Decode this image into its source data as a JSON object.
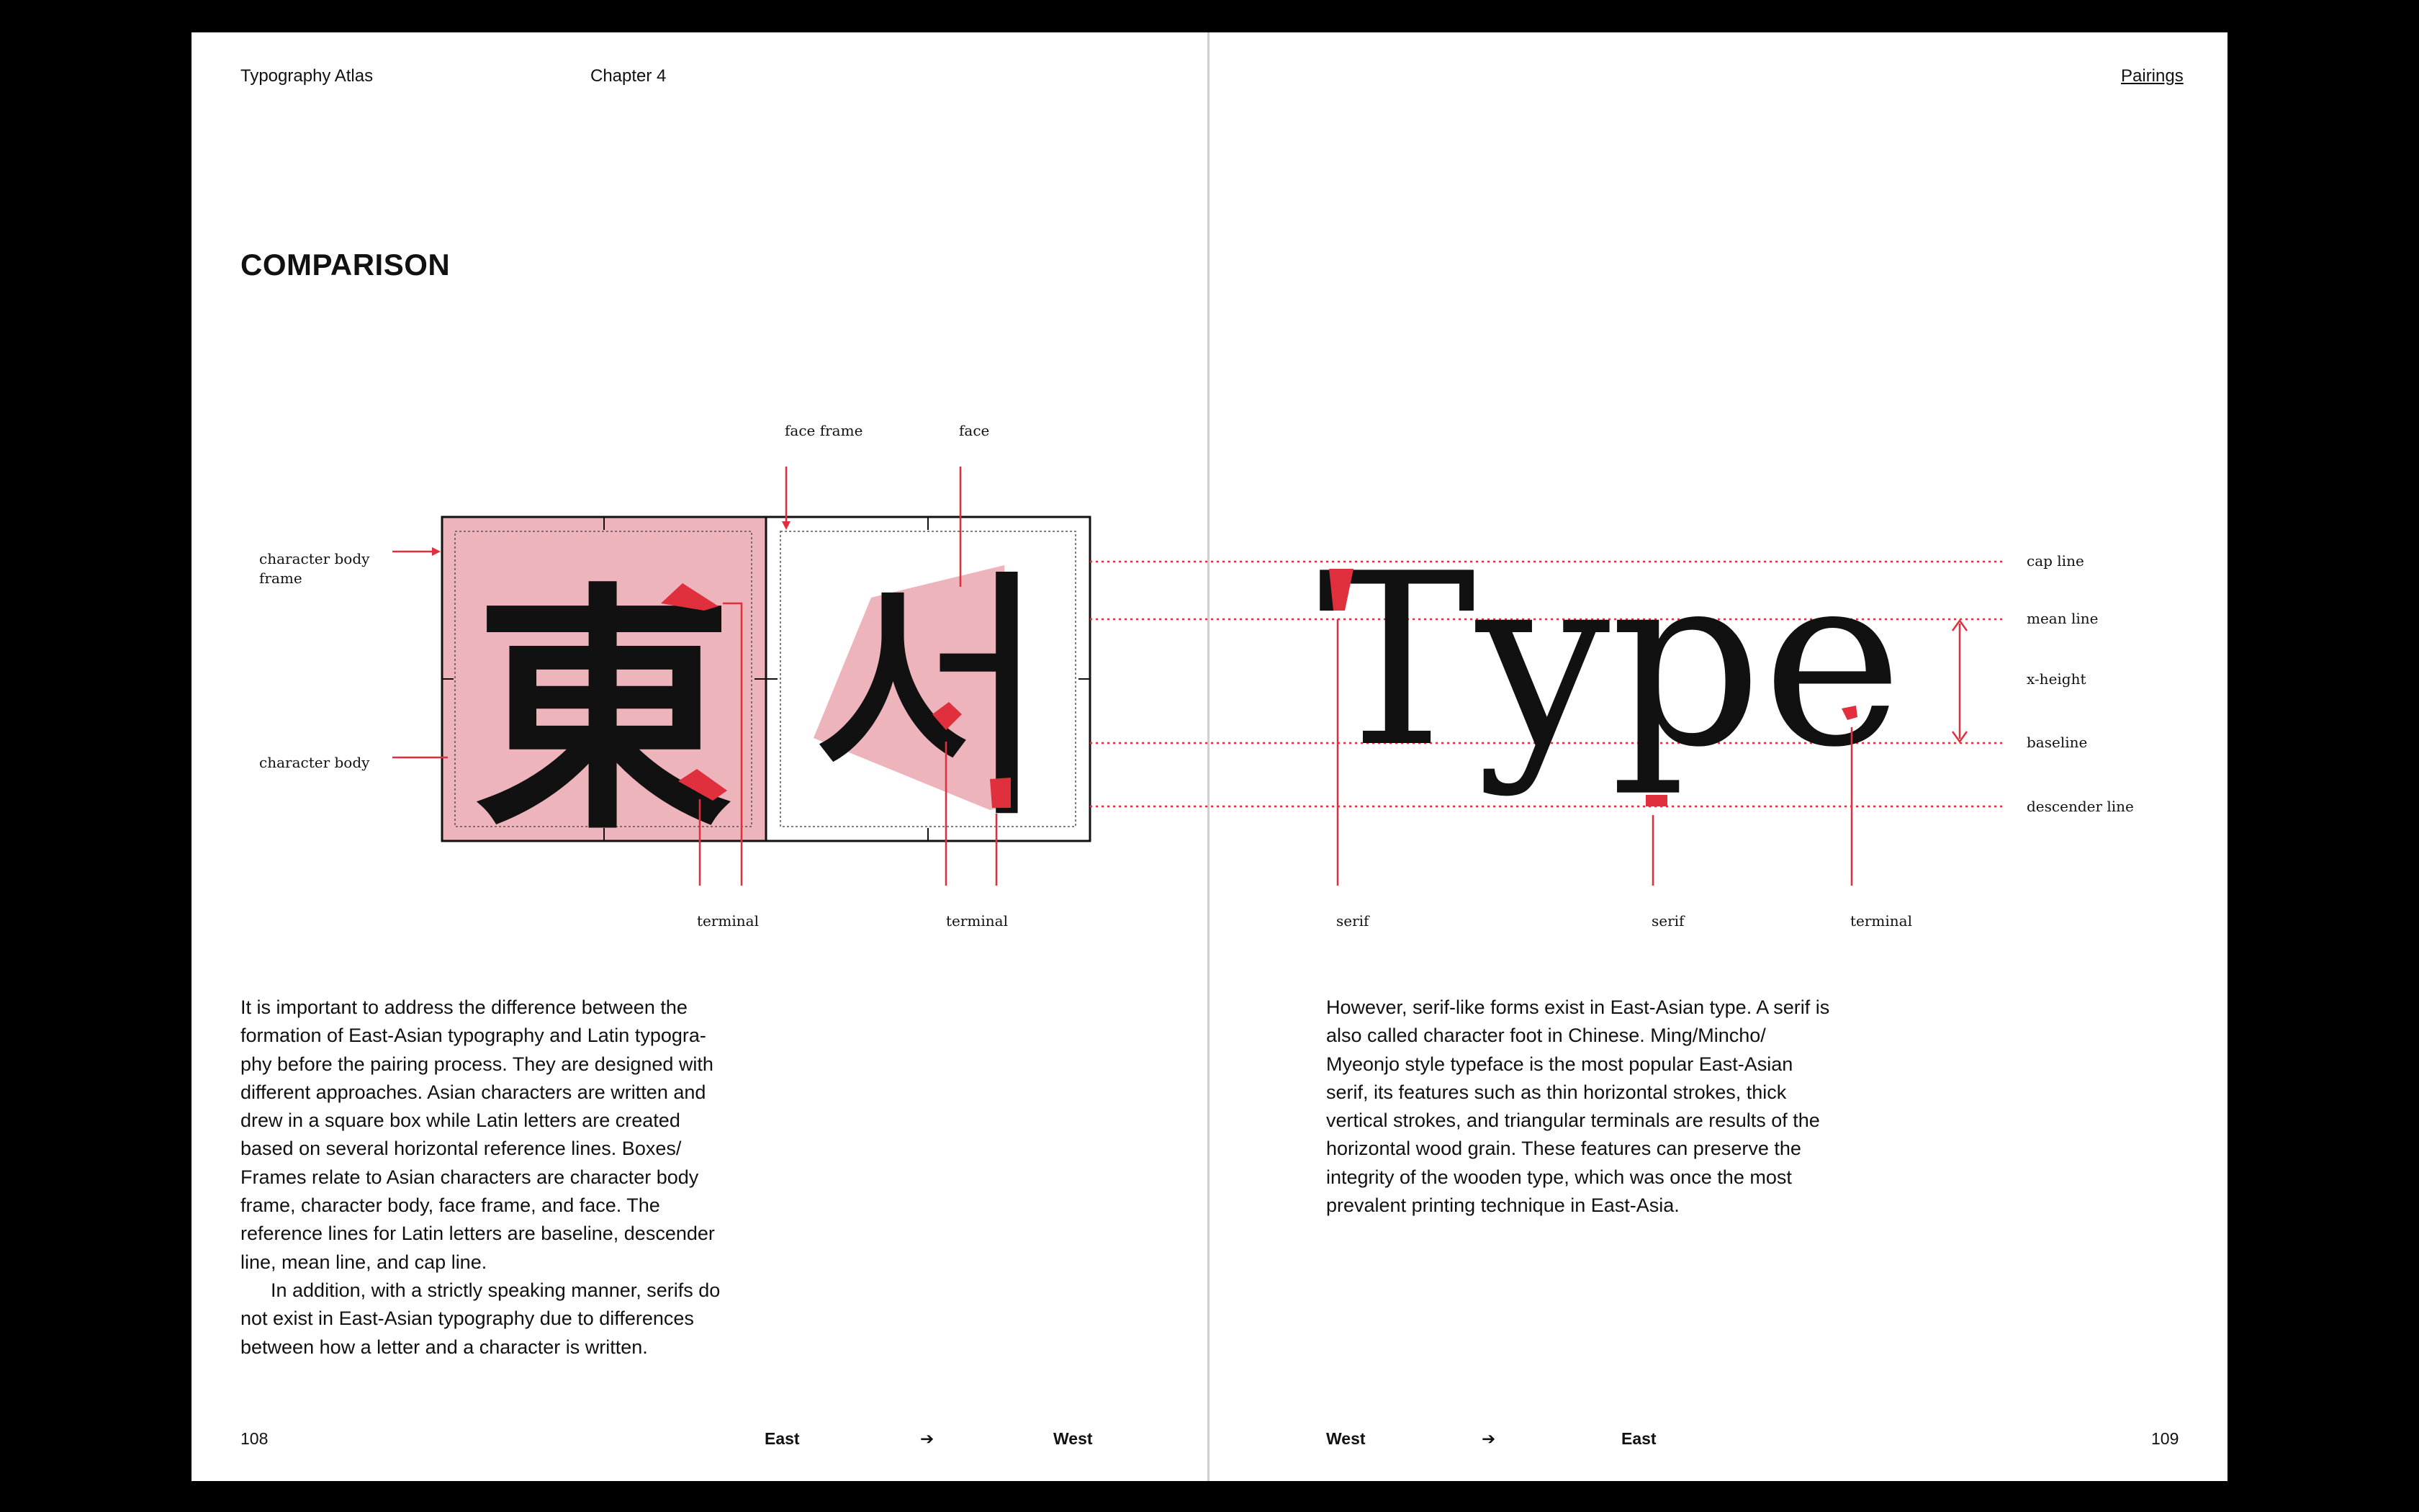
{
  "header": {
    "book_title": "Typography Atlas",
    "chapter": "Chapter 4",
    "section_link": "Pairings"
  },
  "title": "COMPARISON",
  "diagram_left": {
    "glyph_1": "東",
    "glyph_2": "서",
    "labels": {
      "face_frame": "face frame",
      "face": "face",
      "char_body_frame_1": "character body",
      "char_body_frame_2": "frame",
      "char_body": "character body",
      "terminal_1": "terminal",
      "terminal_2": "terminal"
    }
  },
  "diagram_right": {
    "word": "Type",
    "lines": {
      "cap": "cap line",
      "mean": "mean line",
      "x_height": "x-height",
      "baseline": "baseline",
      "descender": "descender line"
    },
    "labels": {
      "serif_1": "serif",
      "serif_2": "serif",
      "terminal": "terminal"
    }
  },
  "left_text": {
    "line_1": "It is important to address the difference between the",
    "line_2": "formation of East-Asian typography and Latin typogra-",
    "line_3": "phy before the pairing process. They are designed with",
    "line_4": "different approaches. Asian characters are written and",
    "line_5": "drew in a square box while Latin letters are created",
    "line_6": "based on several horizontal reference lines. Boxes/",
    "line_7": "Frames relate to Asian characters are character body",
    "line_8": "frame, character body, face frame, and face. The",
    "line_9": "reference lines for Latin letters are baseline, descender",
    "line_10": "line, mean line, and cap line.",
    "line_11": "In addition, with a strictly speaking manner, serifs do",
    "line_12": "not exist in East-Asian typography due to differences",
    "line_13": "between how a letter and a character is written."
  },
  "right_text": {
    "line_1": "However, serif-like forms exist in East-Asian type. A serif is",
    "line_2": "also called character foot in Chinese. Ming/Mincho/",
    "line_3": "Myeonjo style typeface is the most popular East-Asian",
    "line_4": "serif, its features such as thin horizontal strokes, thick",
    "line_5": "vertical strokes, and triangular terminals are results of the",
    "line_6": "horizontal wood grain. These features can preserve the",
    "line_7": "integrity of the wooden type, which was once the most",
    "line_8": "prevalent printing technique in East-Asia."
  },
  "footer_left": {
    "page_number": "108",
    "from": "East",
    "arrow": "➔",
    "to": "West"
  },
  "footer_right": {
    "from": "West",
    "arrow": "➔",
    "to": "East",
    "page_number": "109"
  },
  "colors": {
    "accent_red": "#e0303e",
    "pink_fill": "#eeb4bc",
    "ink": "#111111"
  }
}
